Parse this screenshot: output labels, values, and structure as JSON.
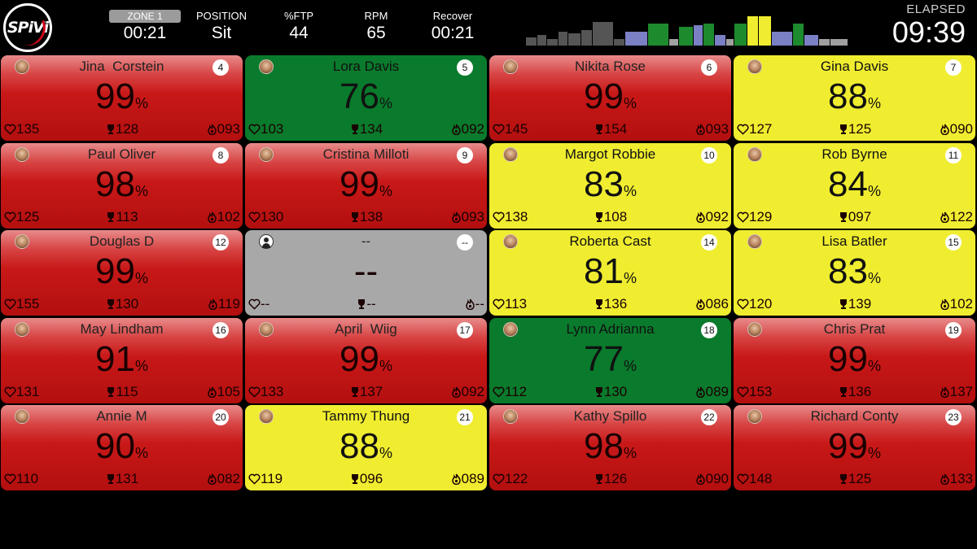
{
  "header": {
    "zone_label": "ZONE 1",
    "zone_time": "00:21",
    "position_label": "POSITION",
    "position_value": "Sit",
    "ftp_label": "%FTP",
    "ftp_value": "44",
    "rpm_label": "RPM",
    "rpm_value": "65",
    "recover_label": "Recover",
    "recover_value": "00:21",
    "elapsed_label": "ELAPSED",
    "elapsed_value": "09:39",
    "logo_text": "SPiVi"
  },
  "colors": {
    "red": "#c81818",
    "green": "#0a7a2c",
    "yellow": "#f0ed30",
    "gray": "#a8a8a8",
    "history_gray": "#555555",
    "history_light": "#a0a0a0",
    "history_blue": "#7b7fc4",
    "history_green": "#1e8a2e",
    "history_yellow": "#f0ed30"
  },
  "history": [
    {
      "color": "history_gray",
      "level": 0.25
    },
    {
      "color": "history_gray",
      "level": 0.35
    },
    {
      "color": "history_gray",
      "level": 0.2
    },
    {
      "color": "history_gray",
      "level": 0.45
    },
    {
      "color": "history_gray",
      "level": 0.4
    },
    {
      "color": "history_gray",
      "level": 0.5
    },
    {
      "color": "history_gray",
      "level": 0.75
    },
    {
      "color": "history_gray",
      "level": 0.2
    },
    {
      "color": "history_blue",
      "level": 0.45
    },
    {
      "color": "history_green",
      "level": 0.7
    },
    {
      "color": "history_light",
      "level": 0.2
    },
    {
      "color": "history_green",
      "level": 0.6
    },
    {
      "color": "history_blue",
      "level": 0.65
    },
    {
      "color": "history_green",
      "level": 0.7
    },
    {
      "color": "history_blue",
      "level": 0.35
    },
    {
      "color": "history_light",
      "level": 0.2
    },
    {
      "color": "history_green",
      "level": 0.7
    },
    {
      "color": "history_yellow",
      "level": 0.95
    },
    {
      "color": "history_yellow",
      "level": 0.95
    },
    {
      "color": "history_blue",
      "level": 0.45
    },
    {
      "color": "history_green",
      "level": 0.7
    },
    {
      "color": "history_blue",
      "level": 0.35
    },
    {
      "color": "history_light",
      "level": 0.2
    },
    {
      "color": "history_light",
      "level": 0.2
    }
  ],
  "riders": [
    {
      "name": "Jina  Corstein",
      "num": "4",
      "pct": "99",
      "hr": "135",
      "cad": "128",
      "pwr": "093",
      "color": "red"
    },
    {
      "name": "Lora Davis",
      "num": "5",
      "pct": "76",
      "hr": "103",
      "cad": "134",
      "pwr": "092",
      "color": "green"
    },
    {
      "name": "Nikita Rose",
      "num": "6",
      "pct": "99",
      "hr": "145",
      "cad": "154",
      "pwr": "093",
      "color": "red"
    },
    {
      "name": "Gina Davis",
      "num": "7",
      "pct": "88",
      "hr": "127",
      "cad": "125",
      "pwr": "090",
      "color": "yellow"
    },
    {
      "name": "Paul Oliver",
      "num": "8",
      "pct": "98",
      "hr": "125",
      "cad": "113",
      "pwr": "102",
      "color": "red"
    },
    {
      "name": "Cristina Milloti",
      "num": "9",
      "pct": "99",
      "hr": "130",
      "cad": "138",
      "pwr": "093",
      "color": "red"
    },
    {
      "name": "Margot Robbie",
      "num": "10",
      "pct": "83",
      "hr": "138",
      "cad": "108",
      "pwr": "092",
      "color": "yellow"
    },
    {
      "name": "Rob Byrne",
      "num": "11",
      "pct": "84",
      "hr": "129",
      "cad": "097",
      "pwr": "122",
      "color": "yellow"
    },
    {
      "name": "Douglas D",
      "num": "12",
      "pct": "99",
      "hr": "155",
      "cad": "130",
      "pwr": "119",
      "color": "red"
    },
    {
      "name": "--",
      "num": "--",
      "pct": "--",
      "hr": "--",
      "cad": "--",
      "pwr": "--",
      "color": "gray",
      "generic": true
    },
    {
      "name": "Roberta Cast",
      "num": "14",
      "pct": "81",
      "hr": "113",
      "cad": "136",
      "pwr": "086",
      "color": "yellow"
    },
    {
      "name": "Lisa Batler",
      "num": "15",
      "pct": "83",
      "hr": "120",
      "cad": "139",
      "pwr": "102",
      "color": "yellow"
    },
    {
      "name": "May Lindham",
      "num": "16",
      "pct": "91",
      "hr": "131",
      "cad": "115",
      "pwr": "105",
      "color": "red"
    },
    {
      "name": "April  Wiig",
      "num": "17",
      "pct": "99",
      "hr": "133",
      "cad": "137",
      "pwr": "092",
      "color": "red"
    },
    {
      "name": "Lynn Adrianna",
      "num": "18",
      "pct": "77",
      "hr": "112",
      "cad": "130",
      "pwr": "089",
      "color": "green"
    },
    {
      "name": "Chris Prat",
      "num": "19",
      "pct": "99",
      "hr": "153",
      "cad": "136",
      "pwr": "137",
      "color": "red"
    },
    {
      "name": "Annie M",
      "num": "20",
      "pct": "90",
      "hr": "110",
      "cad": "131",
      "pwr": "082",
      "color": "red"
    },
    {
      "name": "Tammy Thung",
      "num": "21",
      "pct": "88",
      "hr": "119",
      "cad": "096",
      "pwr": "089",
      "color": "yellow"
    },
    {
      "name": "Kathy Spillo",
      "num": "22",
      "pct": "98",
      "hr": "122",
      "cad": "126",
      "pwr": "090",
      "color": "red"
    },
    {
      "name": "Richard Conty",
      "num": "23",
      "pct": "99",
      "hr": "148",
      "cad": "125",
      "pwr": "133",
      "color": "red"
    }
  ]
}
